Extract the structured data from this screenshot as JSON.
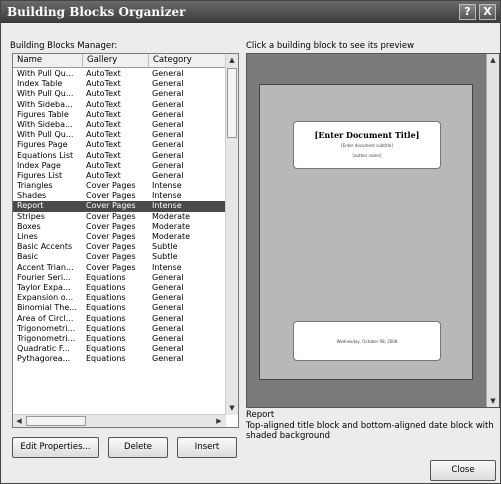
{
  "window": {
    "title": "Building Blocks Organizer",
    "help_label": "?",
    "close_label": "X"
  },
  "manager_label": "Building Blocks Manager:",
  "columns": [
    "Name",
    "Gallery",
    "Category"
  ],
  "rows": [
    [
      "With Pull Qu...",
      "AutoText",
      "General"
    ],
    [
      "Index Table",
      "AutoText",
      "General"
    ],
    [
      "With Pull Qu...",
      "AutoText",
      "General"
    ],
    [
      "With Sideba...",
      "AutoText",
      "General"
    ],
    [
      "Figures Table",
      "AutoText",
      "General"
    ],
    [
      "With Sideba...",
      "AutoText",
      "General"
    ],
    [
      "With Pull Qu...",
      "AutoText",
      "General"
    ],
    [
      "Figures Page",
      "AutoText",
      "General"
    ],
    [
      "Equations List",
      "AutoText",
      "General"
    ],
    [
      "Index Page",
      "AutoText",
      "General"
    ],
    [
      "Figures List",
      "AutoText",
      "General"
    ],
    [
      "Triangles",
      "Cover Pages",
      "Intense"
    ],
    [
      "Shades",
      "Cover Pages",
      "Intense"
    ],
    [
      "Report",
      "Cover Pages",
      "Intense"
    ],
    [
      "Stripes",
      "Cover Pages",
      "Moderate"
    ],
    [
      "Boxes",
      "Cover Pages",
      "Moderate"
    ],
    [
      "Lines",
      "Cover Pages",
      "Moderate"
    ],
    [
      "Basic Accents",
      "Cover Pages",
      "Subtle"
    ],
    [
      "Basic",
      "Cover Pages",
      "Subtle"
    ],
    [
      "Accent Trian...",
      "Cover Pages",
      "Intense"
    ],
    [
      "Fourier Seri...",
      "Equations",
      "General"
    ],
    [
      "Taylor Expa...",
      "Equations",
      "General"
    ],
    [
      "Expansion o...",
      "Equations",
      "General"
    ],
    [
      "Binomial The...",
      "Equations",
      "General"
    ],
    [
      "Area of Circl...",
      "Equations",
      "General"
    ],
    [
      "Trigonometri...",
      "Equations",
      "General"
    ],
    [
      "Trigonometri...",
      "Equations",
      "General"
    ],
    [
      "Quadratic F...",
      "Equations",
      "General"
    ],
    [
      "Pythagorea...",
      "Equations",
      "General"
    ]
  ],
  "selected_index": 13,
  "buttons": {
    "edit": "Edit Properties...",
    "delete": "Delete",
    "insert": "Insert",
    "close": "Close"
  },
  "preview": {
    "hint": "Click a building block to see its preview",
    "doc_title": "[Enter Document Title]",
    "doc_subtitle": "[Enter document subtitle]",
    "author": "[author name]",
    "date": "Wednesday, October 08, 2008",
    "name": "Report",
    "description": "Top-aligned title block and bottom-aligned date block with shaded background"
  }
}
